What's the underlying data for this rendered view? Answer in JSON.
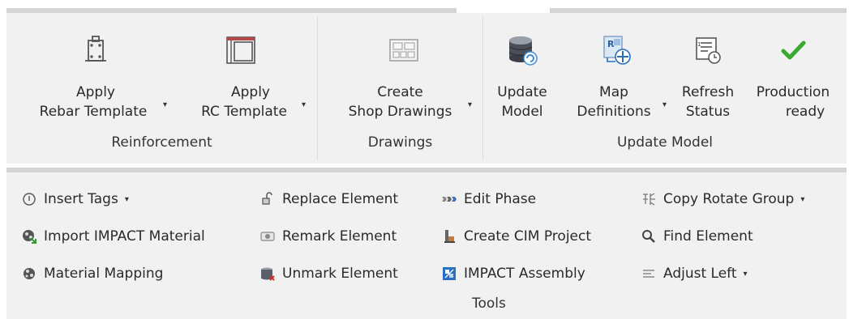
{
  "ribbon": {
    "reinforcement": {
      "label": "Reinforcement",
      "buttons": [
        {
          "line1": "Apply",
          "line2": "Rebar Template",
          "icon": "rebar-template-icon"
        },
        {
          "line1": "Apply",
          "line2": "RC Template",
          "icon": "rc-template-icon"
        }
      ]
    },
    "drawings": {
      "label": "Drawings",
      "buttons": [
        {
          "line1": "Create",
          "line2": "Shop Drawings",
          "icon": "shop-drawings-icon"
        }
      ]
    },
    "update_model": {
      "label": "Update Model",
      "buttons": [
        {
          "line1": "Update",
          "line2": "Model",
          "icon": "database-update-icon"
        },
        {
          "line1": "Map",
          "line2": "Definitions",
          "icon": "map-definitions-icon"
        },
        {
          "line1": "Refresh",
          "line2": "Status",
          "icon": "refresh-status-icon"
        },
        {
          "line1": "Production",
          "line2": "ready",
          "icon": "checkmark-icon",
          "color": "#3aa832"
        }
      ]
    }
  },
  "tools": {
    "label": "Tools",
    "items": [
      {
        "label": "Insert Tags",
        "icon": "tag-icon"
      },
      {
        "label": "Import IMPACT Material",
        "icon": "import-material-icon"
      },
      {
        "label": "Material Mapping",
        "icon": "material-mapping-icon"
      },
      {
        "label": "Replace Element",
        "icon": "replace-element-icon"
      },
      {
        "label": "Remark Element",
        "icon": "remark-element-icon"
      },
      {
        "label": "Unmark Element",
        "icon": "unmark-element-icon"
      },
      {
        "label": "Edit Phase",
        "icon": "edit-phase-icon"
      },
      {
        "label": "Create CIM Project",
        "icon": "cim-project-icon"
      },
      {
        "label": "IMPACT Assembly",
        "icon": "impact-assembly-icon"
      },
      {
        "label": "Copy Rotate Group",
        "icon": "copy-rotate-icon"
      },
      {
        "label": "Find Element",
        "icon": "find-icon"
      },
      {
        "label": "Adjust Left",
        "icon": "align-left-icon"
      }
    ]
  },
  "dropdown_caret": "▾"
}
